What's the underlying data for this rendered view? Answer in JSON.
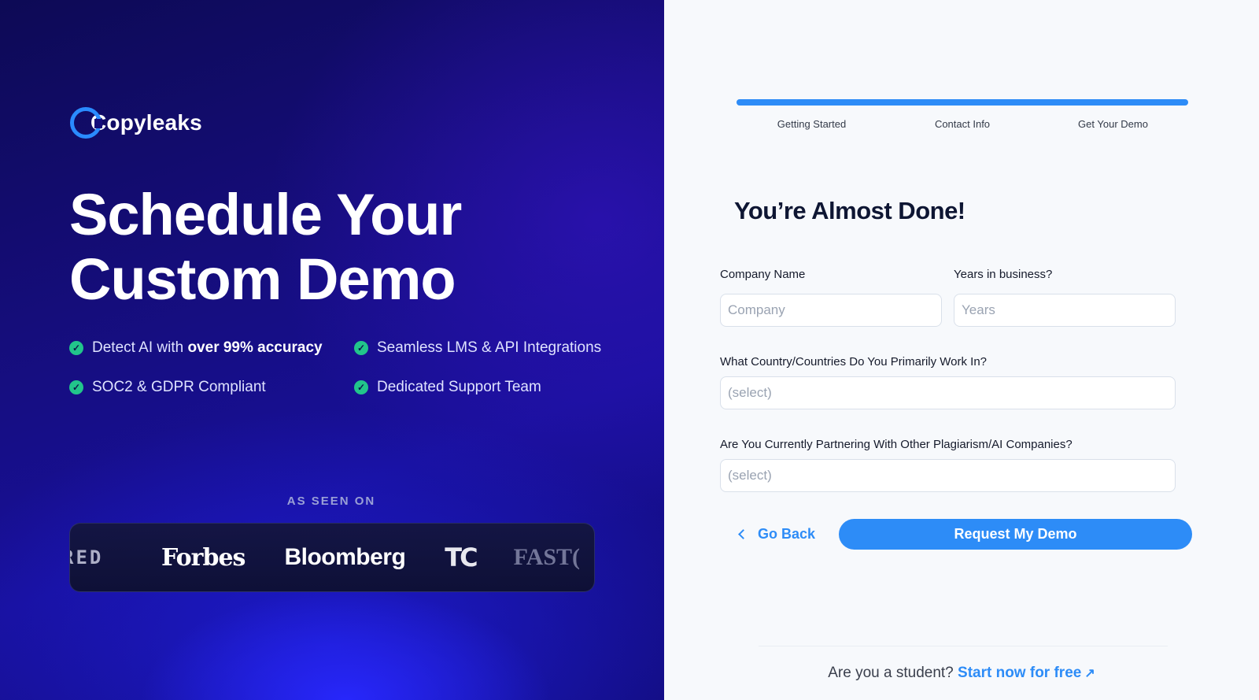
{
  "brand": {
    "name": "Copyleaks"
  },
  "hero": {
    "headline_line1": "Schedule Your",
    "headline_line2": "Custom Demo"
  },
  "features": [
    {
      "prefix": "Detect AI with ",
      "bold": "over 99% accuracy"
    },
    {
      "prefix": "Seamless LMS & API Integrations",
      "bold": ""
    },
    {
      "prefix": "SOC2 & GDPR Compliant",
      "bold": ""
    },
    {
      "prefix": "Dedicated Support Team",
      "bold": ""
    }
  ],
  "press": {
    "label": "AS SEEN ON",
    "logos": [
      "RED",
      "Forbes",
      "Bloomberg",
      "TC",
      "FAST("
    ]
  },
  "progress": {
    "fraction": 1.0,
    "steps": [
      "Getting Started",
      "Contact Info",
      "Get Your Demo"
    ]
  },
  "form": {
    "title": "You’re Almost Done!",
    "company_label": "Company Name",
    "company_placeholder": "Company",
    "years_label": "Years in business?",
    "years_placeholder": "Years",
    "country_label": "What Country/Countries Do You Primarily Work In?",
    "country_value": "(select)",
    "partner_label": "Are You Currently Partnering With Other Plagiarism/AI Companies?",
    "partner_value": "(select)",
    "back_label": "Go Back",
    "submit_label": "Request My Demo"
  },
  "footer": {
    "question": "Are you a student?",
    "link_label": "Start now for free",
    "link_icon": "external-arrow-icon"
  },
  "colors": {
    "accent": "#2d8cf7",
    "check": "#22c58b",
    "panel_dark": "#150d7a"
  }
}
